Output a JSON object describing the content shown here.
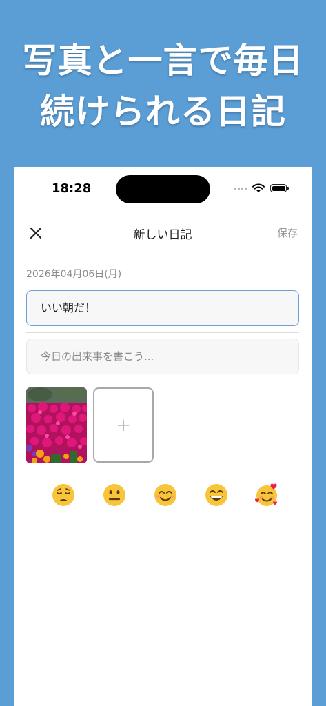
{
  "promo": {
    "line1": "写真と一言で毎日",
    "line2": "続けられる日記"
  },
  "status_bar": {
    "time": "18:28"
  },
  "nav": {
    "title": "新しい日記",
    "save_label": "保存",
    "close_icon": "close-icon"
  },
  "entry": {
    "date": "2026年04月06日(月)",
    "title_value": "いい朝だ！",
    "body_placeholder": "今日の出来事を書こう..."
  },
  "photos": {
    "add_label": "+"
  },
  "moods": [
    {
      "name": "pensive-face"
    },
    {
      "name": "neutral-face"
    },
    {
      "name": "smiling-face"
    },
    {
      "name": "grinning-face"
    },
    {
      "name": "smiling-face-with-hearts"
    }
  ],
  "colors": {
    "background": "#5b9ed6",
    "accent_border": "#6f9fd8",
    "emoji_yellow": "#f7c43a"
  }
}
